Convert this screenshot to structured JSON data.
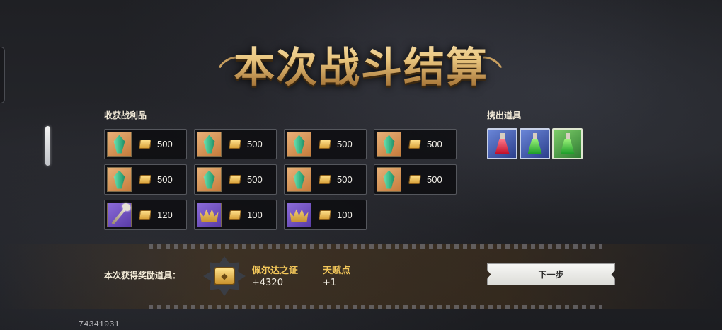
{
  "title": "本次战斗结算",
  "loot": {
    "label": "收获战利品",
    "items": [
      {
        "icon": "green-crystal-icon",
        "bg": "orange",
        "amount": "500"
      },
      {
        "icon": "green-crystal-icon",
        "bg": "orange",
        "amount": "500"
      },
      {
        "icon": "green-crystal-icon",
        "bg": "orange",
        "amount": "500"
      },
      {
        "icon": "green-crystal-icon",
        "bg": "orange",
        "amount": "500"
      },
      {
        "icon": "green-crystal-icon",
        "bg": "orange",
        "amount": "500"
      },
      {
        "icon": "green-crystal-icon",
        "bg": "orange",
        "amount": "500"
      },
      {
        "icon": "green-crystal-icon",
        "bg": "orange",
        "amount": "500"
      },
      {
        "icon": "green-crystal-icon",
        "bg": "orange",
        "amount": "500"
      },
      {
        "icon": "magic-staff-icon",
        "bg": "purple",
        "amount": "120"
      },
      {
        "icon": "golden-crown-icon",
        "bg": "purple",
        "amount": "100"
      },
      {
        "icon": "golden-crown-icon",
        "bg": "purple",
        "amount": "100"
      }
    ]
  },
  "dropped": {
    "label": "携出道具",
    "items": [
      {
        "icon": "red-potion-icon",
        "bg": "blue"
      },
      {
        "icon": "green-potion-icon",
        "bg": "blue"
      },
      {
        "icon": "green-potion-icon",
        "bg": "green"
      }
    ]
  },
  "reward": {
    "label": "本次获得奖励道具：",
    "badge_icon": "golden-badge-icon",
    "items": [
      {
        "name": "佩尔达之证",
        "value": "+4320"
      },
      {
        "name": "天赋点",
        "value": "+1"
      }
    ]
  },
  "next_button": "下一步",
  "footer_id": "74341931",
  "colors": {
    "accent_gold": "#f3c75a",
    "title_gold": "#e9c57e",
    "background": "#222327"
  }
}
